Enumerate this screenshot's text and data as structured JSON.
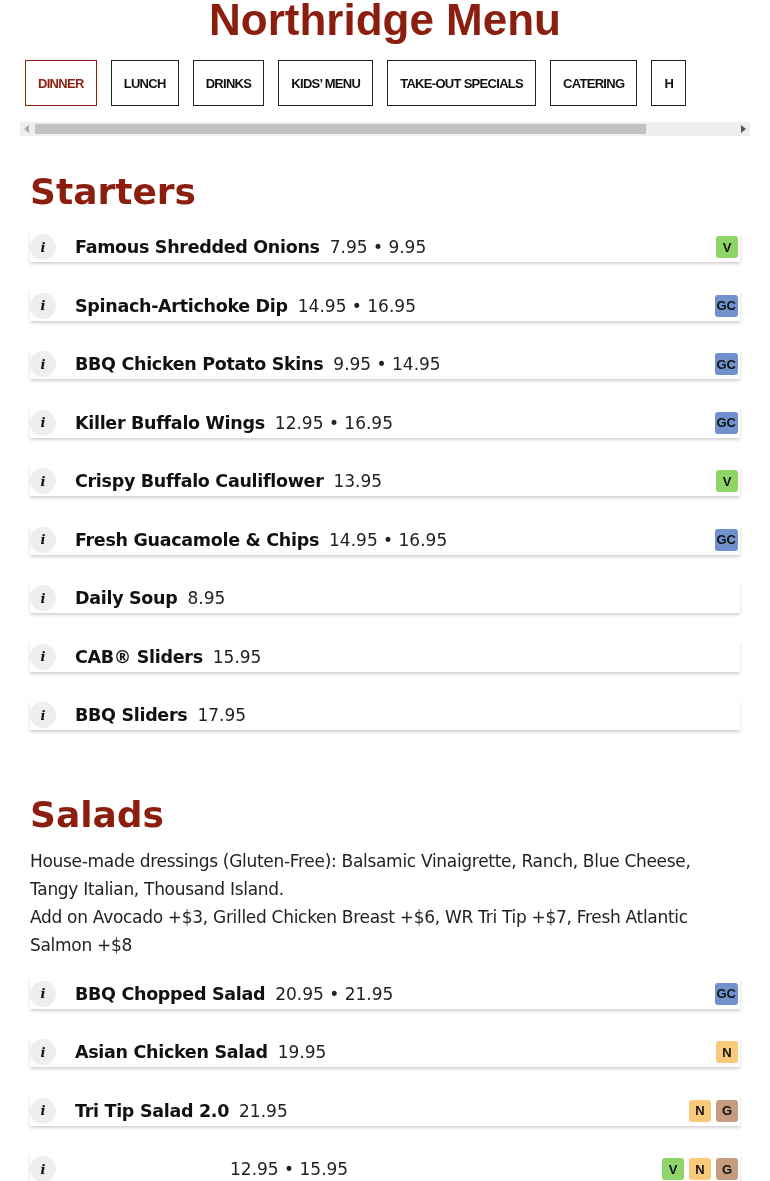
{
  "title": "Northridge Menu",
  "tabs": [
    {
      "label": "DINNER",
      "selected": true
    },
    {
      "label": "LUNCH",
      "selected": false
    },
    {
      "label": "DRINKS",
      "selected": false
    },
    {
      "label": "KIDS’ MENU",
      "selected": false
    },
    {
      "label": "TAKE-OUT SPECIALS",
      "selected": false
    },
    {
      "label": "CATERING",
      "selected": false
    },
    {
      "label": "H",
      "selected": false
    }
  ],
  "sections": [
    {
      "heading": "Starters",
      "items": [
        {
          "info": "i",
          "name": "Famous Shredded Onions",
          "price": "7.95 • 9.95",
          "badges": [
            {
              "label": "V",
              "color": "#8fd468"
            }
          ]
        },
        {
          "info": "i",
          "name": "Spinach-Artichoke Dip",
          "price": "14.95 • 16.95",
          "badges": [
            {
              "label": "GC",
              "color": "#7191cc"
            }
          ]
        },
        {
          "info": "i",
          "name": "BBQ Chicken Potato Skins",
          "price": "9.95 • 14.95",
          "badges": [
            {
              "label": "GC",
              "color": "#7191cc"
            }
          ]
        },
        {
          "info": "i",
          "name": "Killer Buffalo Wings",
          "price": "12.95 • 16.95",
          "badges": [
            {
              "label": "GC",
              "color": "#7191cc"
            }
          ]
        },
        {
          "info": "i",
          "name": "Crispy Buffalo Cauliflower",
          "price": "13.95",
          "badges": [
            {
              "label": "V",
              "color": "#8fd468"
            }
          ]
        },
        {
          "info": "i",
          "name": "Fresh Guacamole & Chips",
          "price": "14.95 • 16.95",
          "badges": [
            {
              "label": "GC",
              "color": "#7191cc"
            }
          ]
        },
        {
          "info": "i",
          "name": "Daily Soup",
          "price": "8.95"
        },
        {
          "info": "i",
          "name": "CAB® Sliders",
          "price": "15.95"
        },
        {
          "info": "i",
          "name": "BBQ Sliders",
          "price": "17.95"
        }
      ]
    },
    {
      "heading": "Salads",
      "notes": [
        "House-made dressings (Gluten-Free): Balsamic Vinaigrette, Ranch, Blue Cheese, Tangy Italian, Thousand Island.",
        "Add on Avocado +$3, Grilled Chicken Breast +$6, WR Tri Tip +$7, Fresh Atlantic Salmon +$8"
      ],
      "items": [
        {
          "info": "i",
          "name": "BBQ Chopped Salad",
          "price": "20.95 • 21.95",
          "badges": [
            {
              "label": "GC",
              "color": "#7191cc"
            }
          ]
        },
        {
          "info": "i",
          "name": "Asian Chicken Salad",
          "price": "19.95",
          "badges": [
            {
              "label": "N",
              "color": "#fbc97c"
            }
          ]
        },
        {
          "info": "i",
          "name": "Tri Tip Salad 2.0",
          "price": "21.95",
          "badges": [
            {
              "label": "N",
              "color": "#fbc97c"
            },
            {
              "label": "G",
              "color": "#c69c7f"
            }
          ]
        },
        {
          "info": "i",
          "price": "12.95 • 15.95",
          "badges": [
            {
              "label": "V",
              "color": "#8fd468"
            },
            {
              "label": "N",
              "color": "#fbc97c"
            },
            {
              "label": "G",
              "color": "#c69c7f"
            }
          ]
        }
      ]
    }
  ]
}
